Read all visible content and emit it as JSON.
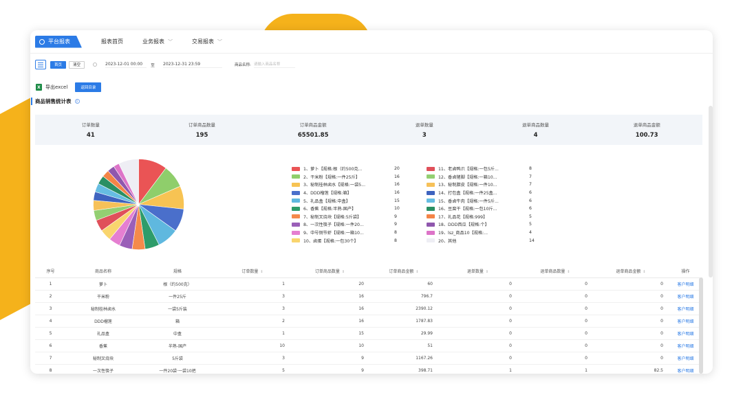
{
  "nav": {
    "active": "平台报表",
    "items": [
      {
        "label": "报表首页",
        "has_dropdown": false
      },
      {
        "label": "业务报表",
        "has_dropdown": true
      },
      {
        "label": "交易报表",
        "has_dropdown": true
      }
    ]
  },
  "filter": {
    "search_label": "首页",
    "clear_label": "清空",
    "start_date": "2023-12-01 00:00",
    "to": "至",
    "end_date": "2023-12-31 23:59",
    "product_label": "商品名称:",
    "product_placeholder": "请输入商品名称"
  },
  "export": {
    "label": "导出excel",
    "back_label": "返回目录"
  },
  "section_title": "商品销售统计表",
  "summary": [
    {
      "label": "订单数量",
      "value": "41"
    },
    {
      "label": "订单商品数量",
      "value": "195"
    },
    {
      "label": "订单商品金额",
      "value": "65501.85"
    },
    {
      "label": "退单数量",
      "value": "3"
    },
    {
      "label": "退单商品数量",
      "value": "4"
    },
    {
      "label": "退单商品金额",
      "value": "100.73"
    }
  ],
  "chart_data": {
    "type": "pie",
    "slices": [
      {
        "label": "1、萝卜【规格:根（约500克...",
        "value": 20,
        "color": "#ea5455"
      },
      {
        "label": "2、干米粉【规格:一件25斤】",
        "value": 16,
        "color": "#8fce6b"
      },
      {
        "label": "3、秘制桂林卤水【规格:一袋5...",
        "value": 16,
        "color": "#f7c353"
      },
      {
        "label": "4、DDD榴莲【规格:箱】",
        "value": 16,
        "color": "#4a6fcb"
      },
      {
        "label": "5、礼品盒【规格:中盒】",
        "value": 15,
        "color": "#5fb8df"
      },
      {
        "label": "6、香蕉【规格:半熟-国产】",
        "value": 10,
        "color": "#2e9c6a"
      },
      {
        "label": "7、秘制叉烧块【规格:5斤袋】",
        "value": 9,
        "color": "#f58a4b"
      },
      {
        "label": "8、一次性筷子【规格:一件20...",
        "value": 9,
        "color": "#9a5fb8"
      },
      {
        "label": "9、中号侧节虾【规格:一箱10...",
        "value": 8,
        "color": "#e57fd1"
      },
      {
        "label": "10、卤蛋【规格:一包30个】",
        "value": 8,
        "color": "#f9d56e"
      },
      {
        "label": "11、老卤鸭爪【规格:一包5斤...",
        "value": 8,
        "color": "#e0505a"
      },
      {
        "label": "12、香卤猪脚【规格:一箱10...",
        "value": 7,
        "color": "#93cf72"
      },
      {
        "label": "13、秘制腊皮【规格:一件10...",
        "value": 7,
        "color": "#f6c159"
      },
      {
        "label": "14、打包盒【规格:一件25盒...",
        "value": 6,
        "color": "#3e63bf"
      },
      {
        "label": "15、香卤牛肉【规格:一件5斤...",
        "value": 6,
        "color": "#66bde2"
      },
      {
        "label": "16、豆腐干【规格:一包10斤...",
        "value": 6,
        "color": "#2a8f63"
      },
      {
        "label": "17、礼品花【规格:999】",
        "value": 5,
        "color": "#f48447"
      },
      {
        "label": "18、DDD西瓜【规格:个】",
        "value": 5,
        "color": "#8f57ad"
      },
      {
        "label": "19、lsz_商品10【规格:...",
        "value": 4,
        "color": "#dd74c8"
      },
      {
        "label": "20、其他",
        "value": 14,
        "color": "#eeeef4"
      }
    ]
  },
  "table": {
    "headers": [
      "序号",
      "商品名称",
      "规格",
      "订单数量",
      "订单商品数量",
      "订单商品金额",
      "退单数量",
      "退单商品数量",
      "退单商品金额",
      "操作"
    ],
    "sortable": [
      false,
      false,
      false,
      true,
      true,
      true,
      true,
      true,
      true,
      false
    ],
    "rows": [
      [
        "1",
        "萝卜",
        "根（约500克）",
        "1",
        "20",
        "60",
        "0",
        "0",
        "0",
        "客户明细"
      ],
      [
        "2",
        "干米粉",
        "一件25斤",
        "3",
        "16",
        "796.7",
        "0",
        "0",
        "0",
        "客户明细"
      ],
      [
        "3",
        "秘制桂林卤水",
        "一袋5斤装",
        "3",
        "16",
        "2390.12",
        "0",
        "0",
        "0",
        "客户明细"
      ],
      [
        "4",
        "DDD榴莲",
        "箱",
        "2",
        "16",
        "1787.83",
        "0",
        "0",
        "0",
        "客户明细"
      ],
      [
        "5",
        "礼品盒",
        "中盒",
        "1",
        "15",
        "29.99",
        "0",
        "0",
        "0",
        "客户明细"
      ],
      [
        "6",
        "香蕉",
        "半熟-国产",
        "10",
        "10",
        "51",
        "0",
        "0",
        "0",
        "客户明细"
      ],
      [
        "7",
        "秘制叉烧块",
        "5斤袋",
        "3",
        "9",
        "1167.26",
        "0",
        "0",
        "0",
        "客户明细"
      ],
      [
        "8",
        "一次性筷子",
        "一件20袋·一袋10把",
        "5",
        "9",
        "398.71",
        "1",
        "1",
        "82.5",
        "客户明细"
      ]
    ]
  }
}
